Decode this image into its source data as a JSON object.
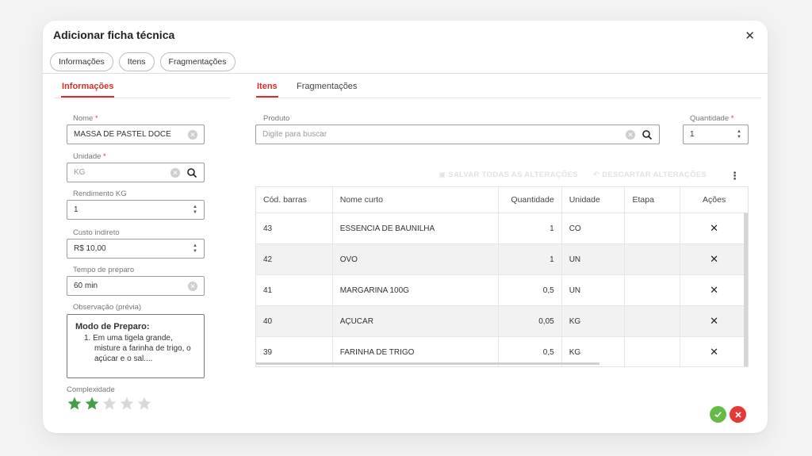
{
  "dialog": {
    "title": "Adicionar ficha técnica",
    "close_icon": "close-icon"
  },
  "chips": [
    "Informações",
    "Itens",
    "Fragmentações"
  ],
  "left": {
    "section_title": "Informações",
    "nome": {
      "label": "Nome",
      "required": "*",
      "value": "MASSA DE PASTEL DOCE"
    },
    "unidade": {
      "label": "Unidade",
      "required": "*",
      "placeholder": "KG"
    },
    "rendimento": {
      "label": "Rendimento KG",
      "value": "1"
    },
    "custo": {
      "label": "Custo indireto",
      "value": "R$ 10,00"
    },
    "tempo": {
      "label": "Tempo de preparo",
      "value": "60 min"
    },
    "observacao": {
      "label": "Observação (prévia)",
      "title": "Modo de Preparo:",
      "step_number": "1.",
      "step_text": "Em uma tigela grande, misture a farinha de trigo, o açúcar e o sal...."
    },
    "complexidade": {
      "label": "Complexidade",
      "rating": 2,
      "max": 5,
      "filled_color": "#43a047",
      "empty_color": "#d9d9d9"
    }
  },
  "right": {
    "tabs": [
      "Itens",
      "Fragmentações"
    ],
    "produto": {
      "label": "Produto",
      "placeholder": "Digite para buscar"
    },
    "quantidade": {
      "label": "Quantidade",
      "required": "*",
      "value": "1"
    },
    "toolbar": {
      "save_all": "SALVAR TODAS AS ALTERAÇÕES",
      "discard": "DESCARTAR ALTERAÇÕES",
      "more_icon": "kebab-menu-icon"
    },
    "table": {
      "headers": [
        "Cód. barras",
        "Nome curto",
        "Quantidade",
        "Unidade",
        "Etapa",
        "Ações"
      ],
      "rows": [
        {
          "codigo": "43",
          "nome": "ESSENCIA DE BAUNILHA",
          "quantidade": "1",
          "unidade": "CO",
          "etapa": "",
          "acao": "✕"
        },
        {
          "codigo": "42",
          "nome": "OVO",
          "quantidade": "1",
          "unidade": "UN",
          "etapa": "",
          "acao": "✕"
        },
        {
          "codigo": "41",
          "nome": "MARGARINA 100G",
          "quantidade": "0,5",
          "unidade": "UN",
          "etapa": "",
          "acao": "✕"
        },
        {
          "codigo": "40",
          "nome": "AÇUCAR",
          "quantidade": "0,05",
          "unidade": "KG",
          "etapa": "",
          "acao": "✕"
        },
        {
          "codigo": "39",
          "nome": "FARINHA DE TRIGO",
          "quantidade": "0,5",
          "unidade": "KG",
          "etapa": "",
          "acao": "✕"
        }
      ]
    }
  },
  "footer": {
    "confirm_icon": "check-icon",
    "cancel_icon": "close-icon",
    "confirm_color": "#66bb44",
    "cancel_color": "#e53935"
  },
  "colors": {
    "accent": "#d32f2f"
  }
}
